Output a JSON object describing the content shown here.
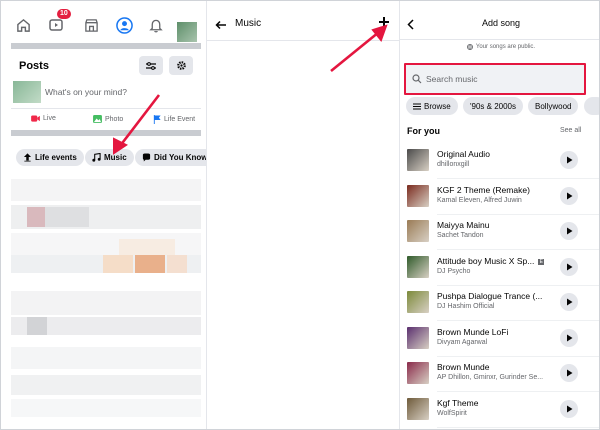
{
  "panel1": {
    "nav": {
      "badge": "10"
    },
    "posts_title": "Posts",
    "composer_placeholder": "What's on your mind?",
    "actions": [
      {
        "label": "Live",
        "icon": "live-video-icon"
      },
      {
        "label": "Photo",
        "icon": "photo-icon"
      },
      {
        "label": "Life Event",
        "icon": "flag-icon"
      }
    ],
    "chips": [
      {
        "label": "Life events",
        "icon": "star-icon"
      },
      {
        "label": "Music",
        "icon": "music-note-icon"
      },
      {
        "label": "Did You Know",
        "icon": "chat-bubble-icon"
      }
    ]
  },
  "panel2": {
    "title": "Music"
  },
  "panel3": {
    "title": "Add song",
    "public_note": "Your songs are public.",
    "search_placeholder": "Search music",
    "filters": [
      {
        "label": "Browse",
        "icon": "menu-icon"
      },
      {
        "label": "'90s & 2000s"
      },
      {
        "label": "Bollywood"
      }
    ],
    "section_title": "For you",
    "see_all": "See all",
    "songs": [
      {
        "title": "Original Audio",
        "artist": "dhillonxgill",
        "explicit": false,
        "color": "#4a4a4a"
      },
      {
        "title": "KGF 2 Theme (Remake)",
        "artist": "Kamal Eleven, Alfred Juwin",
        "explicit": false,
        "color": "#7a2a1e"
      },
      {
        "title": "Maiyya Mainu",
        "artist": "Sachet Tandon",
        "explicit": false,
        "color": "#9a7b55"
      },
      {
        "title": "Attitude boy Music X Sp...",
        "artist": "DJ Psycho",
        "explicit": true,
        "color": "#2f5a2a"
      },
      {
        "title": "Pushpa Dialogue Trance (...",
        "artist": "DJ Hashim Official",
        "explicit": false,
        "color": "#7c8a3a"
      },
      {
        "title": "Brown Munde LoFi",
        "artist": "Divyam Agarwal",
        "explicit": false,
        "color": "#5a2f6e"
      },
      {
        "title": "Brown Munde",
        "artist": "AP Dhillon, Gminxr, Gurinder Se...",
        "explicit": false,
        "color": "#8a2a4a"
      },
      {
        "title": "Kgf Theme",
        "artist": "WolfSpirit",
        "explicit": false,
        "color": "#6e5a3a"
      }
    ]
  },
  "colors": {
    "accent": "#1877f2",
    "annotation": "#e4163f",
    "chip_bg": "#e4e6eb"
  }
}
